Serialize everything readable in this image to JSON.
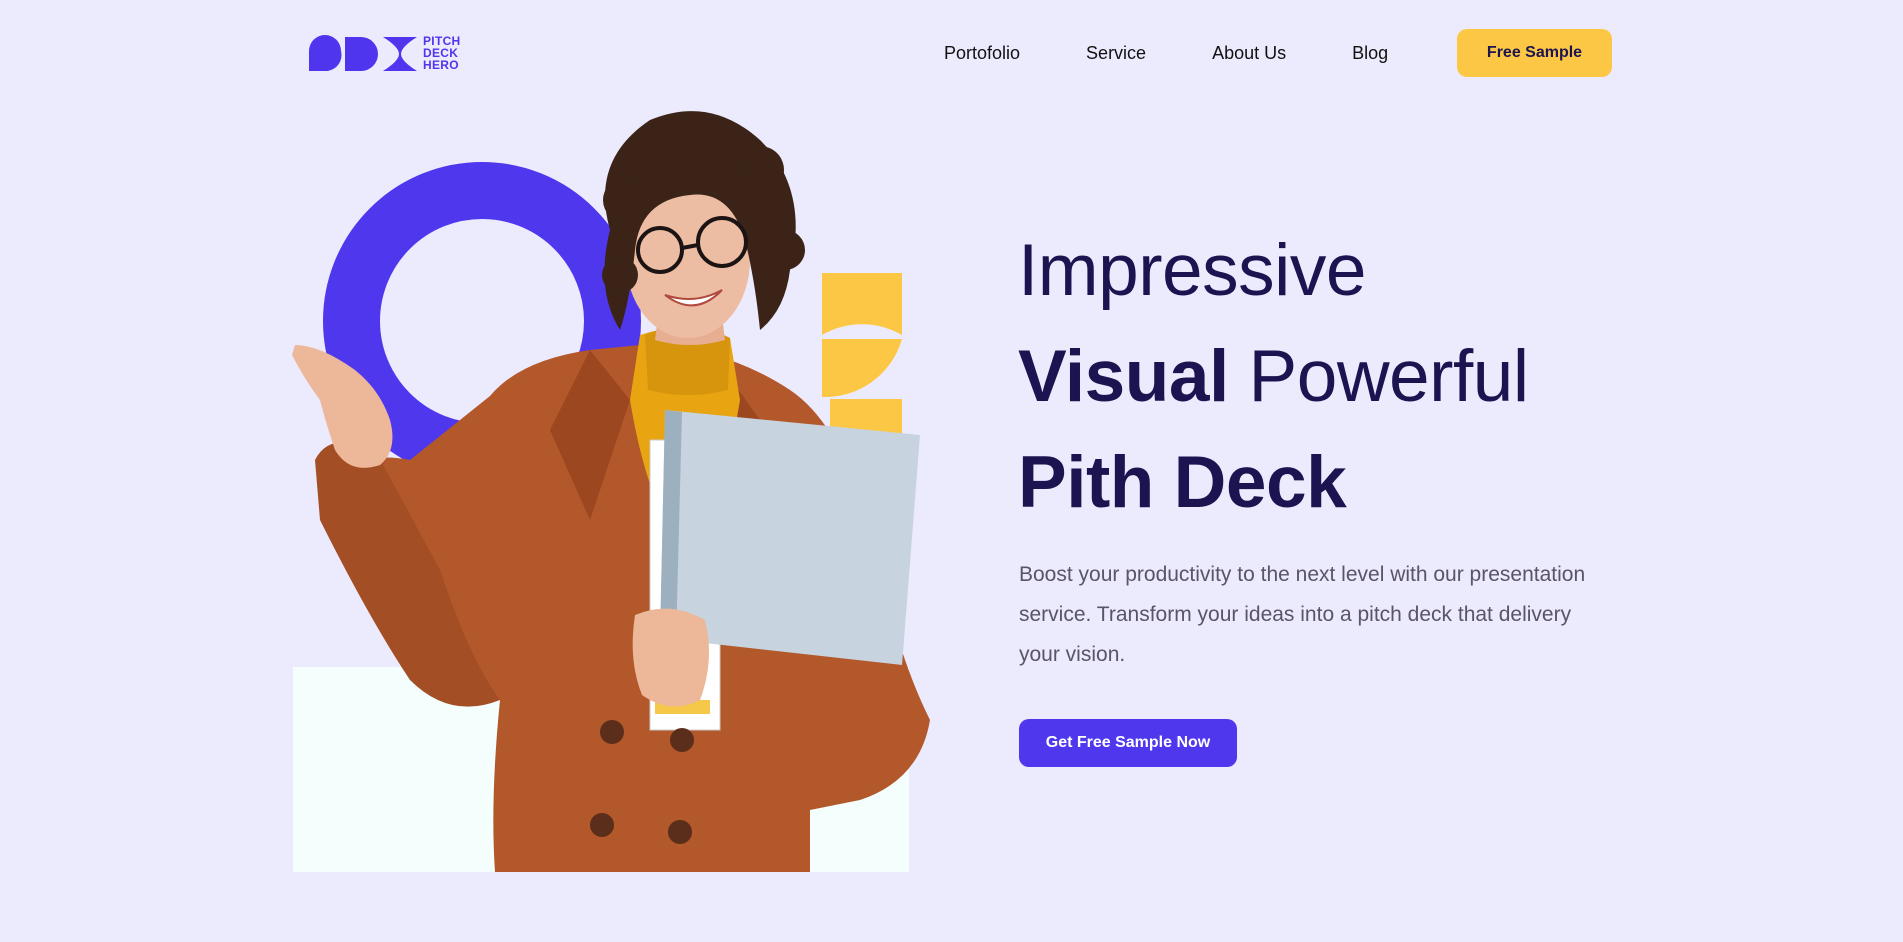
{
  "brand": {
    "logo_lines": [
      "PITCH",
      "DECK",
      "HERO"
    ],
    "color": "#5035EE"
  },
  "nav": {
    "items": [
      "Portofolio",
      "Service",
      "About Us",
      "Blog"
    ],
    "cta_label": "Free Sample"
  },
  "hero": {
    "headline": {
      "line1": "Impressive",
      "line2_bold": "Visual",
      "line2_regular": "Powerful",
      "line3": "Pith Deck"
    },
    "description": "Boost your productivity to the next level with our presentation service. Transform your ideas into a pitch deck that delivery your vision.",
    "cta_label": "Get Free Sample Now"
  },
  "colors": {
    "background": "#ECEAFD",
    "primary": "#4F37EE",
    "accent": "#FDC746",
    "heading": "#1B1450",
    "body_text": "#595566",
    "panel": "#F3FEFD"
  }
}
